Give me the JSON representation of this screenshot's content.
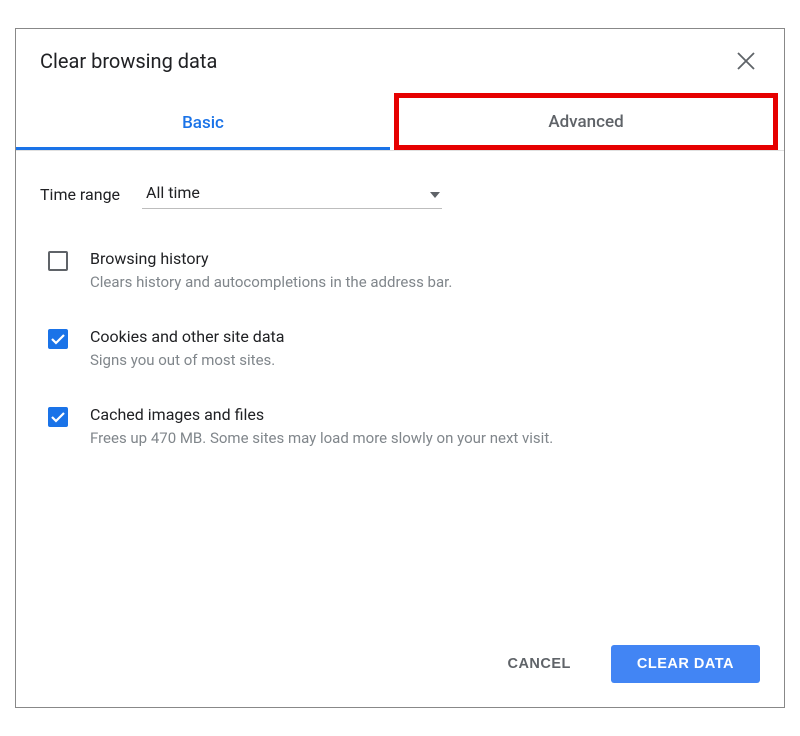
{
  "dialog": {
    "title": "Clear browsing data"
  },
  "tabs": {
    "basic": "Basic",
    "advanced": "Advanced"
  },
  "time_range": {
    "label": "Time range",
    "value": "All time"
  },
  "options": [
    {
      "checked": false,
      "title": "Browsing history",
      "description": "Clears history and autocompletions in the address bar."
    },
    {
      "checked": true,
      "title": "Cookies and other site data",
      "description": "Signs you out of most sites."
    },
    {
      "checked": true,
      "title": "Cached images and files",
      "description": "Frees up 470 MB. Some sites may load more slowly on your next visit."
    }
  ],
  "buttons": {
    "cancel": "CANCEL",
    "clear": "CLEAR DATA"
  }
}
